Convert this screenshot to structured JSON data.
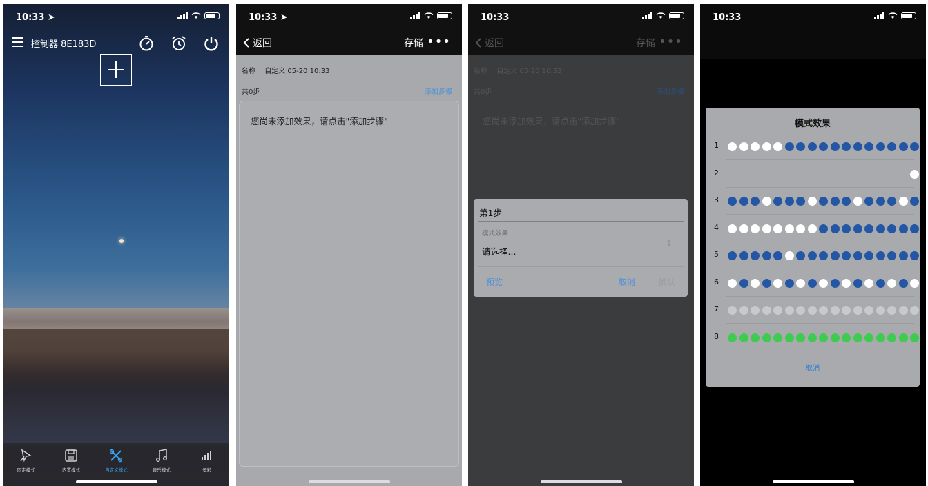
{
  "screen1": {
    "status_time": "10:33 ➤",
    "controller_title": "控制器 8E183D",
    "tabs": [
      {
        "label": "固定模式",
        "icon": "pin-icon",
        "active": false
      },
      {
        "label": "内置模式",
        "icon": "save-icon",
        "active": false
      },
      {
        "label": "自定义模式",
        "icon": "custom-icon",
        "active": true
      },
      {
        "label": "音乐模式",
        "icon": "music-note-icon",
        "active": false
      },
      {
        "label": "多彩",
        "icon": "bars-icon",
        "active": false
      }
    ]
  },
  "screen2": {
    "status_time": "10:33 ➤",
    "back_label": "返回",
    "save_label": "存储",
    "more_label": "•••",
    "name_label": "名称",
    "name_value": "自定义 05-20 10:33",
    "steps_count": "共0步",
    "add_step_label": "添加步骤",
    "empty_hint": "您尚未添加效果，请点击\"添加步骤\""
  },
  "screen3": {
    "status_time": "10:33",
    "back_label": "返回",
    "save_label": "存储",
    "more_label": "•••",
    "name_label": "名称",
    "name_value": "自定义 05-20 10:33",
    "steps_count": "共0步",
    "add_step_label": "添加步骤",
    "empty_hint": "您尚未添加效果，请点击\"添加步骤\"",
    "dialog": {
      "title": "第1步",
      "field_label": "模式效果",
      "select_placeholder": "请选择...",
      "preview_label": "预览",
      "cancel_label": "取消",
      "ok_label": "确认"
    }
  },
  "screen4": {
    "status_time": "10:33",
    "modal_title": "模式效果",
    "cancel_label": "取消",
    "rows": [
      {
        "num": "1",
        "pattern": "WWWWWBBBBBBBBBBBB"
      },
      {
        "num": "2",
        "pattern": "GGGGGGGGGGGGGGGGW"
      },
      {
        "num": "3",
        "pattern": "BBBWBBBWBBBWBBBWB"
      },
      {
        "num": "4",
        "pattern": "WWWWWWWWBBBBBBBBB"
      },
      {
        "num": "5",
        "pattern": "BBBBBWBBBBBBBBBBB"
      },
      {
        "num": "6",
        "pattern": "WBWBWBWBWBWBWBWBW"
      },
      {
        "num": "7",
        "pattern": "LLLLLLLLLLLLLLLLL"
      },
      {
        "num": "8",
        "pattern": "NNNNNNNNNNNNNNNNN"
      }
    ],
    "colors": {
      "B": "#2456a6",
      "W": "#ffffff",
      "L": "#c7c9cc",
      "N": "#3fcb50",
      "G": "#a8aaad"
    }
  }
}
